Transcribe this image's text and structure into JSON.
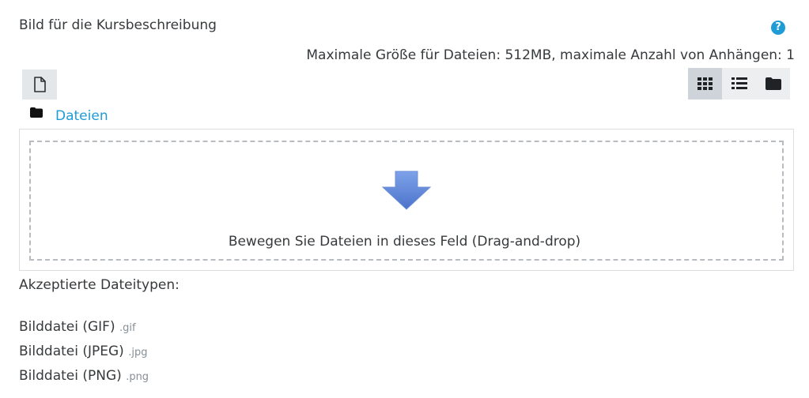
{
  "field": {
    "label": "Bild für die Kursbeschreibung",
    "help_icon": "question-circle-icon",
    "help_glyph": "?"
  },
  "limits": {
    "text": "Maximale Größe für Dateien: 512MB, maximale Anzahl von Anhängen: 1"
  },
  "toolbar": {
    "add_icon": "file-icon",
    "views": [
      {
        "name": "grid-view",
        "icon": "grid-icon",
        "active": true
      },
      {
        "name": "list-view",
        "icon": "list-icon",
        "active": false
      },
      {
        "name": "tree-view",
        "icon": "folder-icon",
        "active": false
      }
    ]
  },
  "breadcrumb": {
    "icon": "folder-icon",
    "label": "Dateien"
  },
  "dropzone": {
    "icon": "arrow-down-icon",
    "text": "Bewegen Sie Dateien in dieses Feld (Drag-and-drop)",
    "arrow_color": "#5b82d6"
  },
  "accepted": {
    "label": "Akzeptierte Dateitypen:",
    "types": [
      {
        "name": "Bilddatei (GIF)",
        "ext": ".gif"
      },
      {
        "name": "Bilddatei (JPEG)",
        "ext": ".jpg"
      },
      {
        "name": "Bilddatei (PNG)",
        "ext": ".png"
      }
    ]
  },
  "colors": {
    "link": "#1f9cd6",
    "text": "#373a3c",
    "button_bg": "#e4e7ea",
    "button_active_bg": "#ced4da"
  }
}
